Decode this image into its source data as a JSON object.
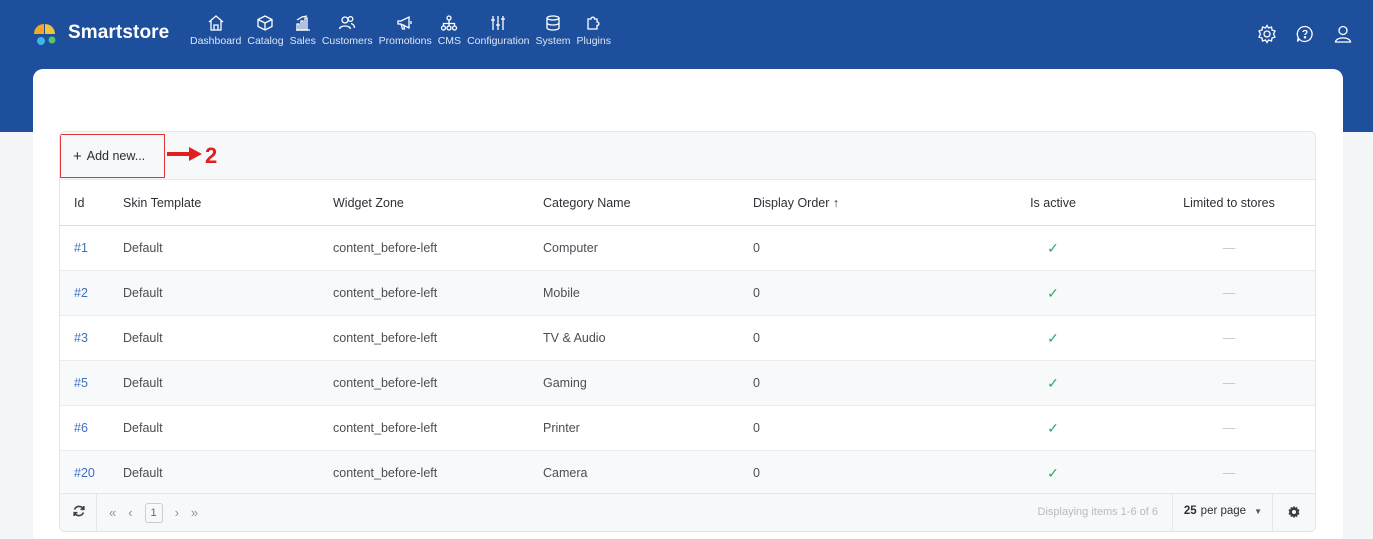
{
  "brand": {
    "name": "Smartstore"
  },
  "nav": [
    {
      "label": "Dashboard",
      "icon": "home-icon"
    },
    {
      "label": "Catalog",
      "icon": "box-icon"
    },
    {
      "label": "Sales",
      "icon": "bar-chart-icon"
    },
    {
      "label": "Customers",
      "icon": "users-icon"
    },
    {
      "label": "Promotions",
      "icon": "megaphone-icon"
    },
    {
      "label": "CMS",
      "icon": "sitemap-icon"
    },
    {
      "label": "Configuration",
      "icon": "sliders-icon"
    },
    {
      "label": "System",
      "icon": "database-icon"
    },
    {
      "label": "Plugins",
      "icon": "puzzle-icon"
    }
  ],
  "toolbar": {
    "add_new": "Add new...",
    "annotation_number": "2"
  },
  "table": {
    "columns": [
      "Id",
      "Skin Template",
      "Widget Zone",
      "Category Name",
      "Display Order ↑",
      "Is active",
      "Limited to stores"
    ],
    "rows": [
      {
        "id": "#1",
        "skin": "Default",
        "zone": "content_before-left",
        "category": "Computer",
        "order": "0",
        "active": "✓",
        "stores": "—"
      },
      {
        "id": "#2",
        "skin": "Default",
        "zone": "content_before-left",
        "category": "Mobile",
        "order": "0",
        "active": "✓",
        "stores": "—"
      },
      {
        "id": "#3",
        "skin": "Default",
        "zone": "content_before-left",
        "category": "TV & Audio",
        "order": "0",
        "active": "✓",
        "stores": "—"
      },
      {
        "id": "#5",
        "skin": "Default",
        "zone": "content_before-left",
        "category": "Gaming",
        "order": "0",
        "active": "✓",
        "stores": "—"
      },
      {
        "id": "#6",
        "skin": "Default",
        "zone": "content_before-left",
        "category": "Printer",
        "order": "0",
        "active": "✓",
        "stores": "—"
      },
      {
        "id": "#20",
        "skin": "Default",
        "zone": "content_before-left",
        "category": "Camera",
        "order": "0",
        "active": "✓",
        "stores": "—"
      }
    ]
  },
  "pager": {
    "first": "«",
    "prev": "‹",
    "current_page": "1",
    "next": "›",
    "last": "»",
    "display_info": "Displaying items 1-6 of 6",
    "per_page_value": "25",
    "per_page_suffix": "per page"
  },
  "colors": {
    "header": "#1d4f9c",
    "accent": "#3f6fbf",
    "annotation": "#e02020",
    "check": "#2fa866"
  }
}
